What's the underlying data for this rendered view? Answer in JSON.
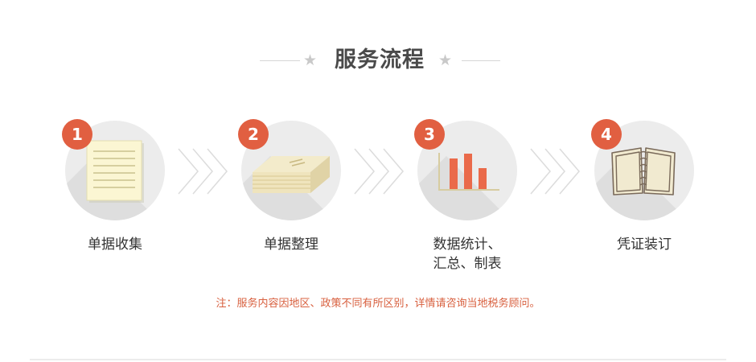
{
  "header": {
    "title": "服务流程",
    "star_left_icon": "star-icon",
    "star_right_icon": "star-icon"
  },
  "steps": [
    {
      "number": "1",
      "label": "单据收集",
      "icon": "document-icon"
    },
    {
      "number": "2",
      "label": "单据整理",
      "icon": "paper-stack-icon"
    },
    {
      "number": "3",
      "label_line1": "数据统计、",
      "label_line2": "汇总、制表",
      "icon": "bar-chart-icon"
    },
    {
      "number": "4",
      "label": "凭证装订",
      "icon": "spiral-book-icon"
    }
  ],
  "note": "注：服务内容因地区、政策不同有所区别，详情请咨询当地税务顾问。",
  "colors": {
    "accent": "#e15f41",
    "note_text": "#d8603f",
    "circle_bg": "#ececec",
    "title_text": "#4a4a4a"
  }
}
